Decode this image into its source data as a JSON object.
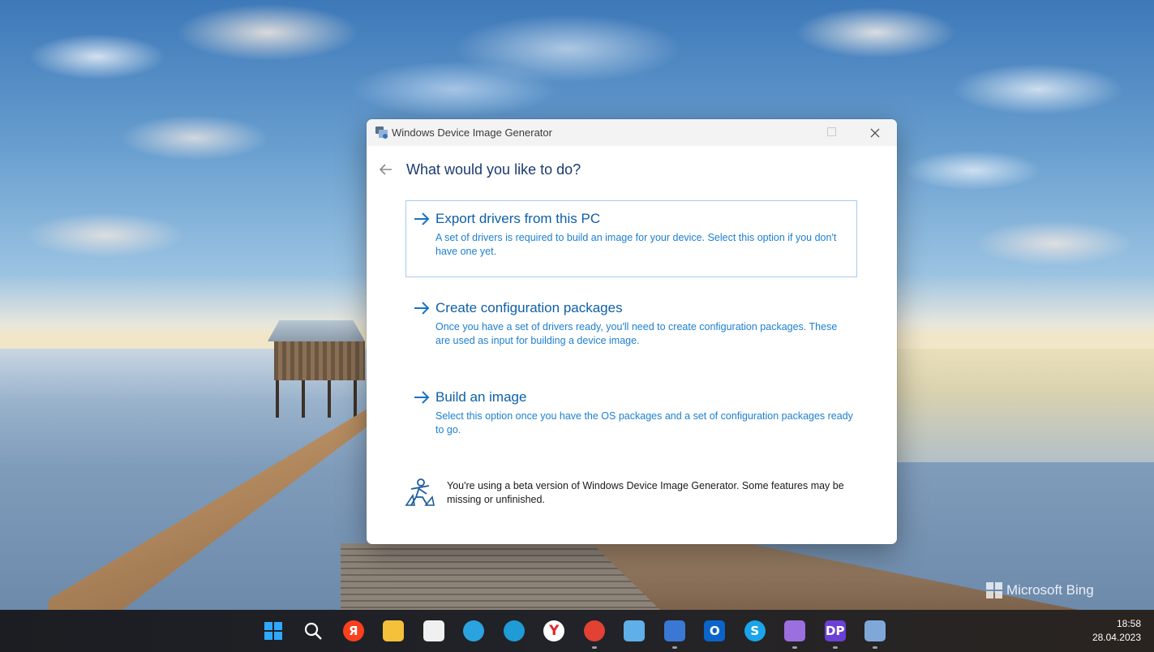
{
  "window": {
    "title": "Windows Device Image Generator",
    "heading": "What would you like to do?",
    "options": [
      {
        "title": "Export drivers from this PC",
        "description": "A set of drivers is required to build an image for your device. Select this option if you don't have one yet.",
        "selected": true
      },
      {
        "title": "Create configuration packages",
        "description": "Once you have a set of drivers ready, you'll need to create configuration packages. These are used as input for building a device image.",
        "selected": false
      },
      {
        "title": "Build an image",
        "description": "Select this option once you have the OS packages and a set of configuration packages ready to go.",
        "selected": false
      }
    ],
    "beta_notice": "You're using a beta version of Windows Device Image Generator. Some features may be missing or unfinished."
  },
  "desktop": {
    "watermark": "Microsoft Bing"
  },
  "taskbar": {
    "apps": [
      {
        "name": "start-icon",
        "glyph": "",
        "color": "#1a8cff",
        "running": false
      },
      {
        "name": "search-icon",
        "glyph": "",
        "color": "transparent",
        "running": false
      },
      {
        "name": "yandex-icon",
        "glyph": "Я",
        "color": "#fc3f1d",
        "running": false
      },
      {
        "name": "file-explorer-icon",
        "glyph": "",
        "color": "#f5c03a",
        "running": false
      },
      {
        "name": "microsoft-store-icon",
        "glyph": "",
        "color": "#f0f0f0",
        "running": false
      },
      {
        "name": "telegram-icon",
        "glyph": "",
        "color": "#2aa3e0",
        "running": false
      },
      {
        "name": "edge-icon",
        "glyph": "",
        "color": "#1f9bd6",
        "running": false
      },
      {
        "name": "yandex-browser-icon",
        "glyph": "Y",
        "color": "#ffffff",
        "running": false
      },
      {
        "name": "chrome-icon",
        "glyph": "",
        "color": "#e34133",
        "running": true
      },
      {
        "name": "notepad-icon",
        "glyph": "",
        "color": "#5fb0e8",
        "running": false
      },
      {
        "name": "save-disk-icon",
        "glyph": "",
        "color": "#3a78d4",
        "running": true
      },
      {
        "name": "outlook-icon",
        "glyph": "O",
        "color": "#0a64c9",
        "running": false
      },
      {
        "name": "skype-icon",
        "glyph": "S",
        "color": "#1ba4ea",
        "running": false
      },
      {
        "name": "visual-studio-icon",
        "glyph": "",
        "color": "#9b6fe0",
        "running": true
      },
      {
        "name": "dotpeek-icon",
        "glyph": "DP",
        "color": "#6b40d6",
        "running": true
      },
      {
        "name": "device-image-generator-icon",
        "glyph": "",
        "color": "#7fa8d8",
        "running": true
      }
    ],
    "clock": {
      "time": "18:58",
      "date": "28.04.2023"
    }
  }
}
